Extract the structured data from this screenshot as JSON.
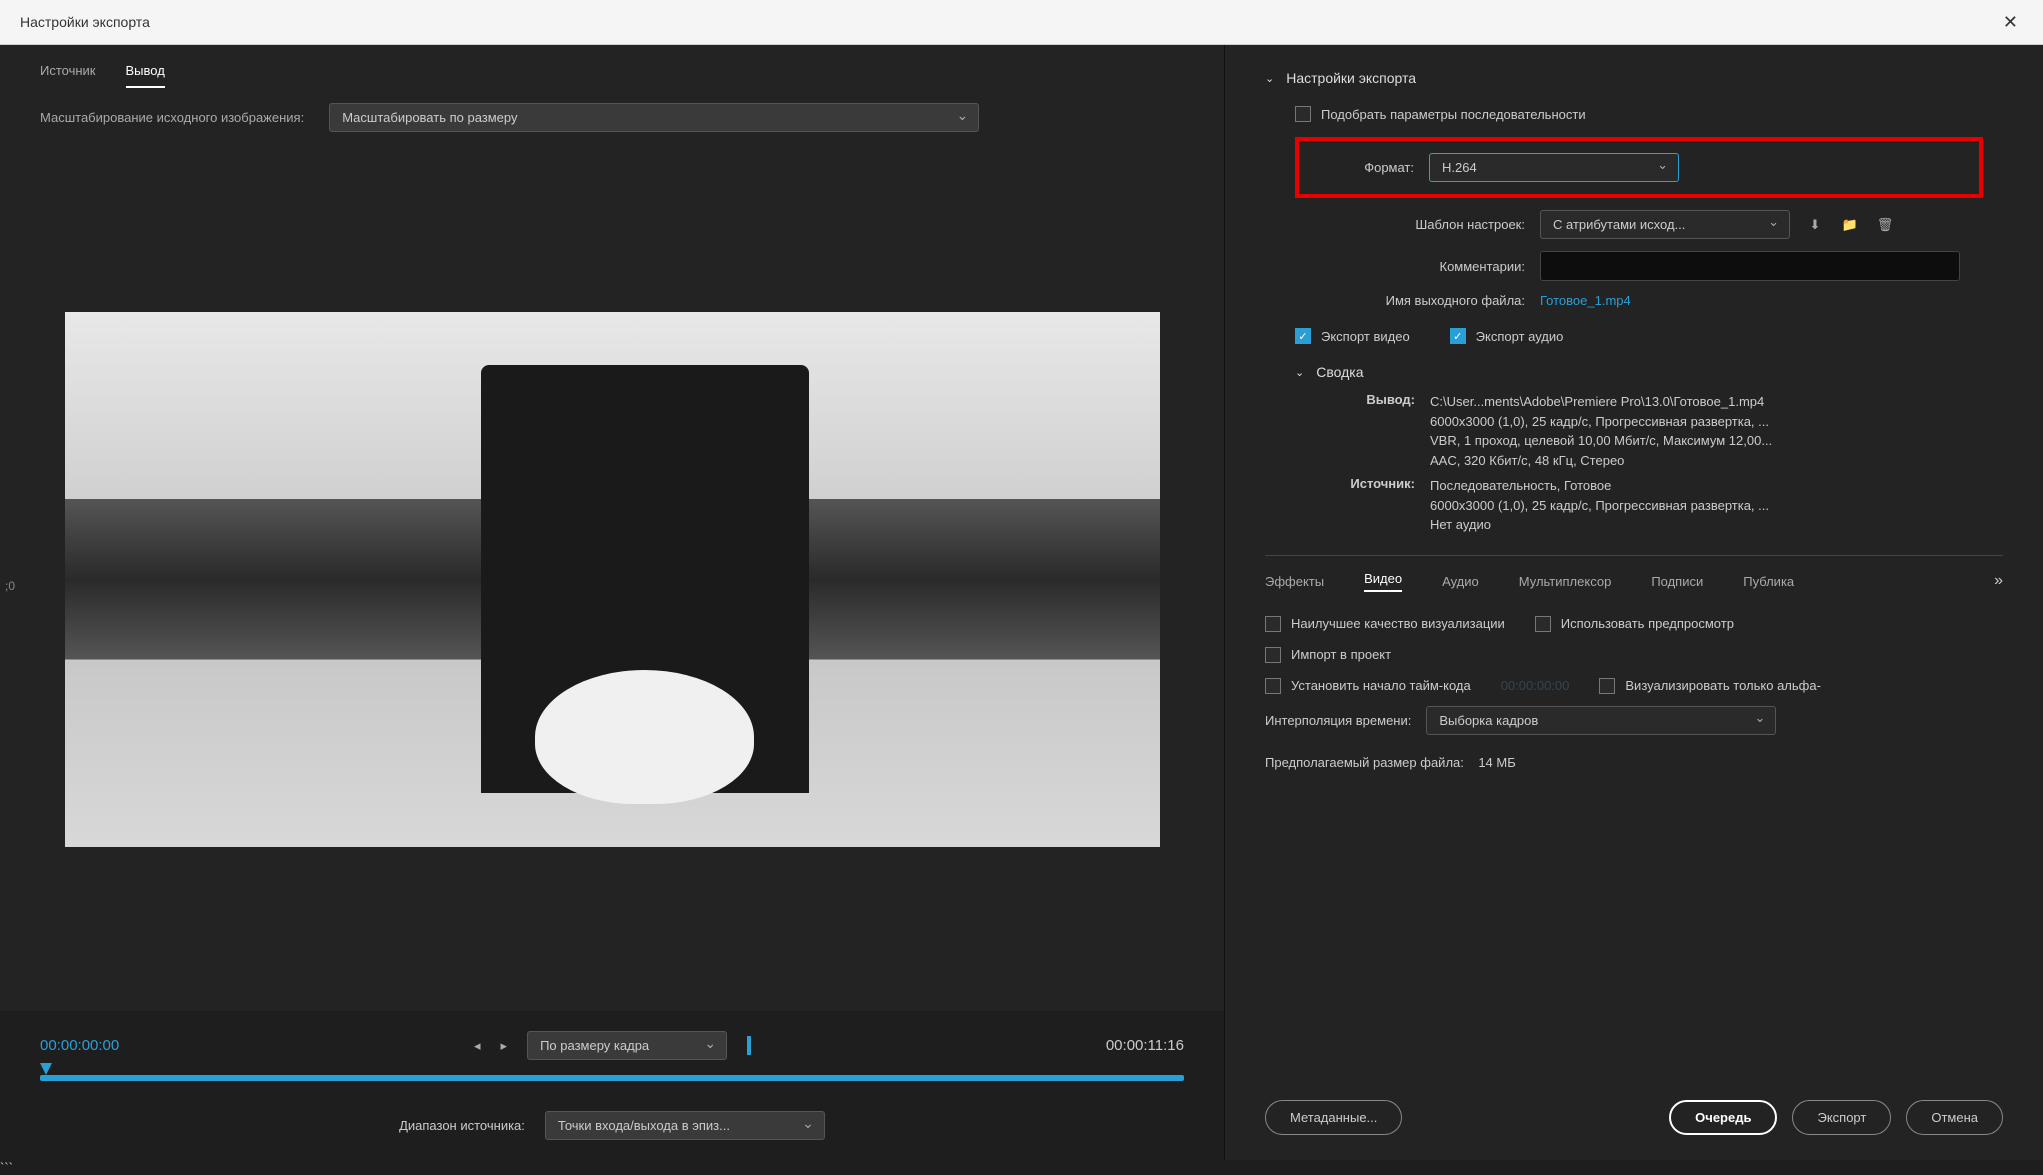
{
  "titlebar": {
    "title": "Настройки экспорта"
  },
  "leftPanel": {
    "tabs": {
      "source": "Источник",
      "output": "Вывод"
    },
    "scaleLabel": "Масштабирование исходного изображения:",
    "scaleValue": "Масштабировать по размеру",
    "sideTimestamp": ";0",
    "tcStart": "00:00:00:00",
    "tcEnd": "00:00:11:16",
    "fitDropdown": "По размеру кадра",
    "rangeLabel": "Диапазон источника:",
    "rangeValue": "Точки входа/выхода в эпиз..."
  },
  "rightPanel": {
    "header": "Настройки экспорта",
    "matchSeq": "Подобрать параметры последовательности",
    "formatLabel": "Формат:",
    "formatValue": "H.264",
    "presetLabel": "Шаблон настроек:",
    "presetValue": "С атрибутами исход...",
    "commentsLabel": "Комментарии:",
    "outNameLabel": "Имя выходного файла:",
    "outNameValue": "Готовое_1.mp4",
    "exportVideo": "Экспорт видео",
    "exportAudio": "Экспорт аудио",
    "summaryHeader": "Сводка",
    "summary": {
      "outputLabel": "Вывод:",
      "outputText": "C:\\User...ments\\Adobe\\Premiere Pro\\13.0\\Готовое_1.mp4\n6000x3000 (1,0), 25 кадр/с, Прогрессивная развертка, ...\nVBR, 1 проход, целевой 10,00 Мбит/с, Максимум 12,00...\nAAC, 320 Кбит/с, 48 кГц, Стерео",
      "sourceLabel": "Источник:",
      "sourceText": "Последовательность, Готовое\n6000x3000 (1,0), 25 кадр/с, Прогрессивная развертка, ...\nНет аудио"
    },
    "subTabs": {
      "effects": "Эффекты",
      "video": "Видео",
      "audio": "Аудио",
      "mux": "Мультиплексор",
      "captions": "Подписи",
      "publish": "Публика"
    },
    "bestQuality": "Наилучшее качество визуализации",
    "usePreview": "Использовать предпросмотр",
    "importProject": "Импорт в проект",
    "setTCStart": "Установить начало тайм-кода",
    "tcValue": "00:00:00:00",
    "alphaOnly": "Визуализировать только альфа-",
    "timeInterpLabel": "Интерполяция времени:",
    "timeInterpValue": "Выборка кадров",
    "filesizeLabel": "Предполагаемый размер файла:",
    "filesizeValue": "14 МБ",
    "buttons": {
      "metadata": "Метаданные...",
      "queue": "Очередь",
      "export": "Экспорт",
      "cancel": "Отмена"
    }
  }
}
